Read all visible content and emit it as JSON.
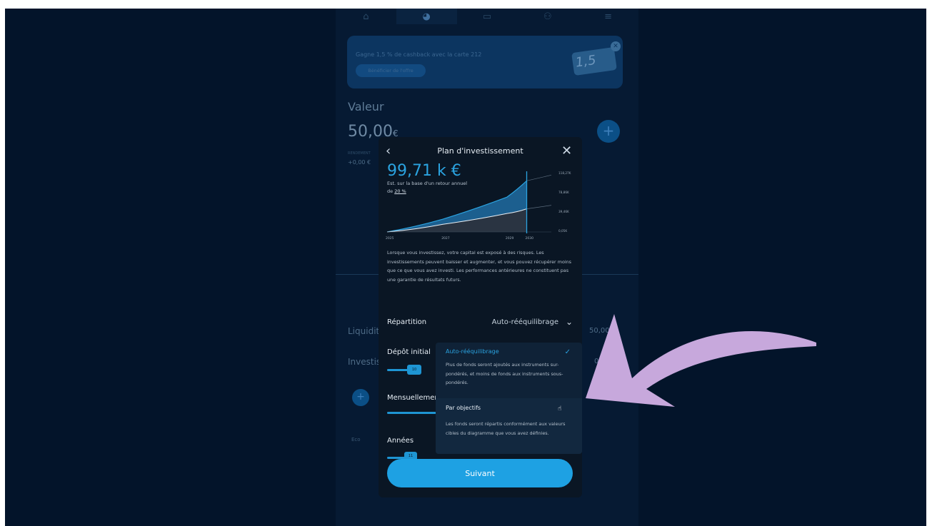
{
  "nav": {
    "icons": [
      "home-icon",
      "pie-chart-icon",
      "card-icon",
      "users-icon",
      "menu-icon"
    ]
  },
  "promo": {
    "text": "Gagne 1,5 % de cashback avec la carte 212",
    "button": "Bénéficier de l'offre",
    "card_text": "1,5"
  },
  "portfolio": {
    "value_label": "Valeur",
    "value": "50,00",
    "currency": "€",
    "perf_label": "RENDEMENT",
    "perf_value": "+0,00 €",
    "liquidity_label": "Liquidit",
    "liquidity_value": "50,00",
    "invest_label": "Investis",
    "invest_value": "0",
    "eco_label": "Eco"
  },
  "modal": {
    "title": "Plan d'investissement",
    "amount": "99,71 k €",
    "estimate": "Est. sur la base d'un retour annuel",
    "estimate_prefix": "de ",
    "estimate_rate": "20 %",
    "disclaimer": "Lorsque vous investissez, votre capital est exposé à des risques. Les investissements peuvent baisser et augmenter, et vous pouvez récupérer moins que ce que vous avez investi. Les performances antérieures ne constituent pas une garantie de résultats futurs.",
    "repartition_label": "Répartition",
    "repartition_value": "Auto-rééquilibrage",
    "depot_label": "Dépôt initial",
    "mensuel_label": "Mensuellement",
    "annees_label": "Années",
    "depot_thumb": "10",
    "annees_thumb": "11",
    "next_button": "Suivant"
  },
  "dropdown": {
    "option1_title": "Auto-rééquilibrage",
    "option1_desc": "Plus de fonds seront ajoutés aux instruments sur-pondérés, et moins de fonds aux instruments sous-pondérés.",
    "option2_title": "Par objectifs",
    "option2_desc": "Les fonds seront répartis conformément aux valeurs cibles du diagramme que vous avez définies."
  },
  "chart_data": {
    "type": "area",
    "x": [
      "2025",
      "2027",
      "2029",
      "2030"
    ],
    "y_ticks": [
      "0,05K",
      "39,46K",
      "78,86K",
      "118,27K"
    ],
    "series": [
      {
        "values": [
          0.05,
          25,
          68,
          99.71
        ]
      },
      {
        "values": [
          0.05,
          15,
          36,
          45
        ]
      }
    ],
    "highlight_x": "2030",
    "colors": {
      "projection": "#1c5f8f",
      "base": "#2a3442",
      "marker": "#2ba3e0"
    }
  },
  "colors": {
    "accent": "#1ea1e3",
    "overlay_arrow": "#c7a8dc"
  }
}
